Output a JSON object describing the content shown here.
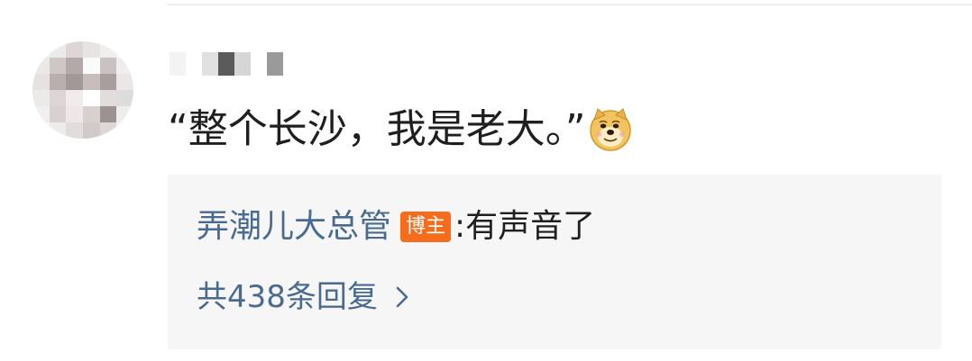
{
  "comment": {
    "text": "“整个长沙，我是老大。”",
    "emoji": "doge-icon"
  },
  "reply": {
    "author": "弄潮儿大总管",
    "badge": "博主",
    "colon": ":",
    "text": "有声音了",
    "count_label": "共438条回复"
  },
  "colors": {
    "link": "#4a6b8f",
    "badge": "#f56d1c",
    "reply_bg": "#f6f6f6",
    "text": "#1f1f1f"
  }
}
